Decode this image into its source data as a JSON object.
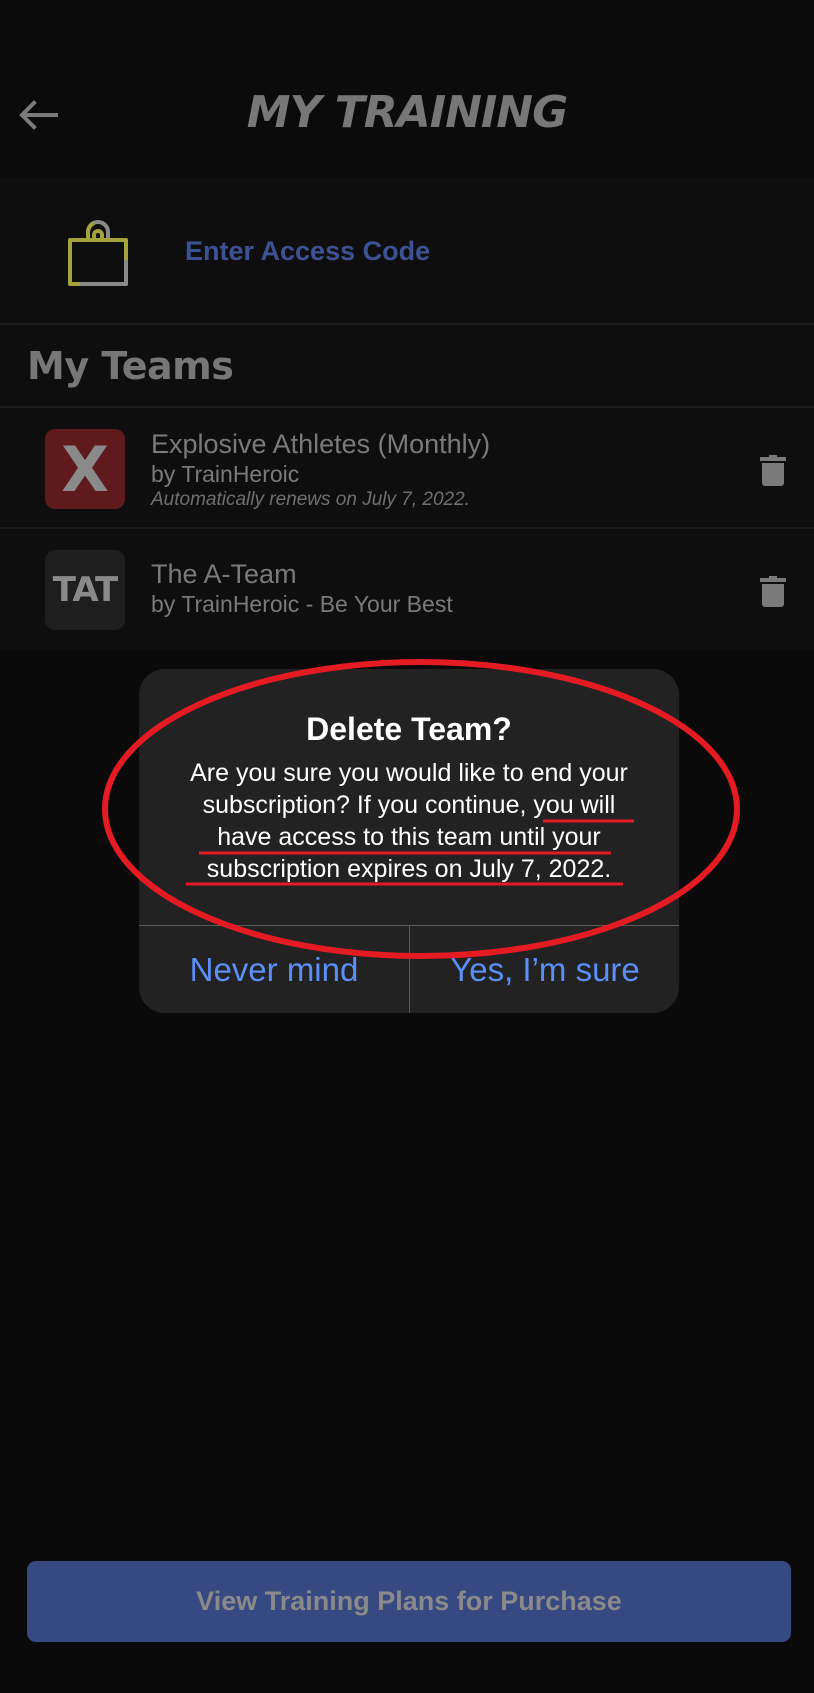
{
  "header": {
    "title": "MY TRAINING",
    "back_icon": "arrow-left-icon"
  },
  "access_code": {
    "icon": "lock-icon",
    "label": "Enter Access Code",
    "colors": {
      "label": "#3d5294",
      "lock_accent": "#a3a33a",
      "lock_track": "#8a8a8a"
    }
  },
  "teams": {
    "heading": "My Teams",
    "items": [
      {
        "avatar_text": "X",
        "avatar_color": "#5e1a1c",
        "name": "Explosive Athletes (Monthly)",
        "by": "by TrainHeroic",
        "note": "Automatically renews on July 7, 2022.",
        "action_icon": "trash-icon"
      },
      {
        "avatar_text": "TAT",
        "avatar_color": "#1e1e1e",
        "name": "The A-Team",
        "by": "by TrainHeroic - Be Your Best",
        "note": null,
        "action_icon": "trash-icon"
      }
    ]
  },
  "dialog": {
    "title": "Delete Team?",
    "body": "Are you sure you would like to end your subscription? If you continue, you will have access to this team until your subscription expires on July 7, 2022.",
    "body_lines": [
      "Are you sure you would like to end your",
      "subscription? If you continue, you will",
      "have access to this team until your",
      "subscription expires on July 7, 2022."
    ],
    "cancel_label": "Never mind",
    "confirm_label": "Yes, I’m sure",
    "colors": {
      "button_text": "#5b8ff5",
      "background": "#222222"
    }
  },
  "annotation": {
    "type": "red-ellipse-with-underlines",
    "color": "#e41b23",
    "highlighted_text": "you will have access to this team until your subscription expires on July 7, 2022"
  },
  "footer": {
    "purchase_label": "View Training Plans for Purchase",
    "button_color": "#364980"
  }
}
